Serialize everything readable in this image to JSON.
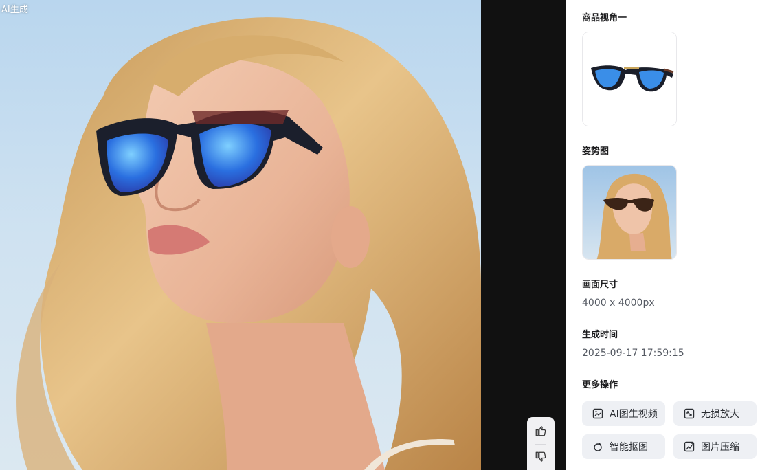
{
  "viewer": {
    "ai_tag": "AI生成"
  },
  "details": {
    "product_view": {
      "title": "商品视角一"
    },
    "pose": {
      "title": "姿势图"
    },
    "size": {
      "title": "画面尺寸",
      "value": "4000 x 4000px"
    },
    "time": {
      "title": "生成时间",
      "value": "2025-09-17 17:59:15"
    },
    "more": {
      "title": "更多操作",
      "actions": [
        {
          "label": "AI图生视频",
          "icon": "image-to-video-icon"
        },
        {
          "label": "无损放大",
          "icon": "upscale-icon"
        },
        {
          "label": "智能抠图",
          "icon": "smart-cutout-icon"
        },
        {
          "label": "图片压缩",
          "icon": "image-compress-icon"
        }
      ]
    }
  },
  "feedback": {
    "up_icon": "thumbs-up-icon",
    "down_icon": "thumbs-down-icon"
  },
  "colors": {
    "panel_bg": "#ffffff",
    "viewer_bg": "#111111",
    "button_bg": "#eef0f4",
    "lens_blue": "#2a6fe0"
  }
}
